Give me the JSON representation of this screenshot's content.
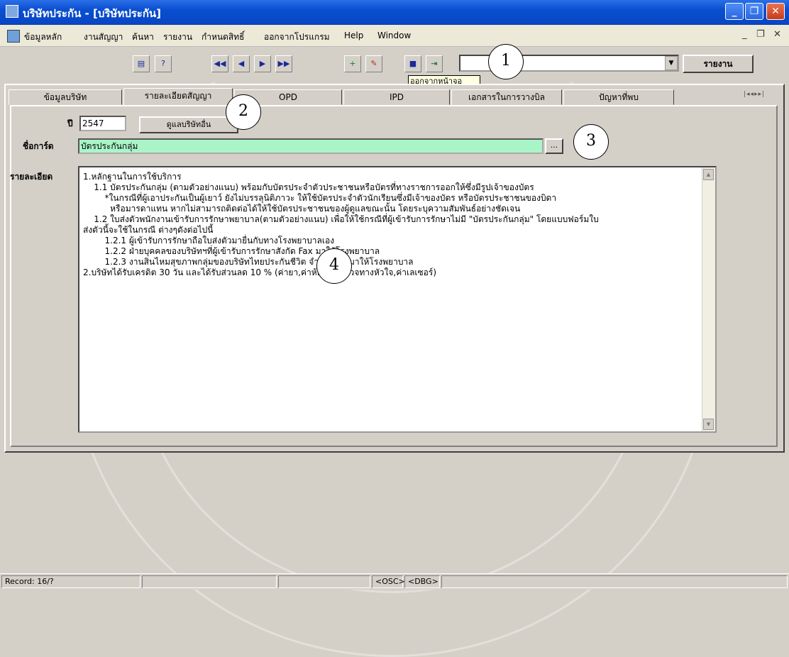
{
  "window": {
    "title": "บริษัทประกัน - [บริษัทประกัน]"
  },
  "menu": [
    "ข้อมูลหลัก",
    "งานสัญญา",
    "ค้นหา",
    "รายงาน",
    "กำหนดสิทธิ์",
    "ออกจากโปรแกรม",
    "Help",
    "Window"
  ],
  "mdi_controls": {
    "minimize": "_",
    "restore": "❐",
    "close": "✕"
  },
  "toolbar": {
    "buttons": [
      {
        "name": "print-icon",
        "glyph": "▤"
      },
      {
        "name": "help-icon",
        "glyph": "?"
      },
      {
        "name": "first-record-icon",
        "glyph": "◀◀"
      },
      {
        "name": "prev-record-icon",
        "glyph": "◀"
      },
      {
        "name": "next-record-icon",
        "glyph": "▶"
      },
      {
        "name": "last-record-icon",
        "glyph": "▶▶"
      },
      {
        "name": "new-record-icon",
        "glyph": "+"
      },
      {
        "name": "delete-record-icon",
        "glyph": "✎"
      },
      {
        "name": "save-icon",
        "glyph": "■"
      },
      {
        "name": "exit-icon",
        "glyph": "⇥"
      }
    ],
    "combo_value": "",
    "report_button": "รายงาน",
    "tooltip": "ออกจากหน้าจอ"
  },
  "callouts": [
    "1",
    "2",
    "3",
    "4"
  ],
  "tabs": [
    "ข้อมูลบริษัท",
    "รายละเอียดสัญญา",
    "OPD",
    "IPD",
    "เอกสารในการวางบิล",
    "ปัญหาที่พบ"
  ],
  "form": {
    "year_label": "ปี",
    "year_value": "2547",
    "care_button": "ดูแลบริษัทอื่น",
    "card_label": "ชื่อการ์ด",
    "card_value": "บัตรประกันกลุ่ม",
    "card_lookup": "...",
    "detail_label": "รายละเอียด",
    "detail_lines": [
      "1.หลักฐานในการใช้บริการ",
      "    1.1 บัตรประกันกลุ่ม (ตามตัวอย่างแนบ) พร้อมกับบัตรประจำตัวประชาชนหรือบัตรที่ทางราชการออกให้ซึ่งมีรูปเจ้าของบัตร",
      "        *ในกรณีที่ผู้เอาประกันเป็นผู้เยาว์ ยังไม่บรรลุนิติภาวะ ให้ใช้บัตรประจำตัวนักเรียนซึ่งมีเจ้าของบัตร หรือบัตรประชาชนของบิดา",
      "          หรือมารดาแทน หากไม่สามารถติดต่อได้ให้ใช้บัตรประชาชนของผู้ดูแลขณะนั้น โดยระบุความสัมพันธ์อย่างชัดเจน",
      "    1.2 ใบส่งตัวพนักงานเข้ารับการรักษาพยาบาล(ตามตัวอย่างแนบ) เพื่อให้ใช้กรณีที่ผู้เข้ารับการรักษาไม่มี \"บัตรประกันกลุ่ม\" โดยแบบฟอร์มใบ",
      "ส่งตัวนี้จะใช้ในกรณี ต่างๆดังต่อไปนี้",
      "        1.2.1 ผู้เข้ารับการรักษาถือใบส่งตัวมายื่นกับทางโรงพยาบาลเอง",
      "        1.2.2 ฝ่ายบุคคลของบริษัทฯที่ผู้เข้ารับการรักษาสังกัด Fax มาให้โรงพยาบาล",
      "        1.2.3 งานสินไหมสุขภาพกลุ่มของบริษัทไทยประกันชีวิต จำกัด Fax มาให้โรงพยาบาล",
      "2.บริษัทได้รับเครดิต 30 วัน และได้รับส่วนลด 10 % (ค่ายา,ค่าห้อง,ค่าตรวจทางหัวใจ,ค่าเลเซอร์)"
    ]
  },
  "status": {
    "record": "Record: 16/?",
    "osc": "<OSC>",
    "dbg": "<DBG>"
  },
  "colors": {
    "titlebar": "#0a4fd0",
    "highlight_field": "#aaf5c8",
    "tooltip": "#ffffe1"
  }
}
